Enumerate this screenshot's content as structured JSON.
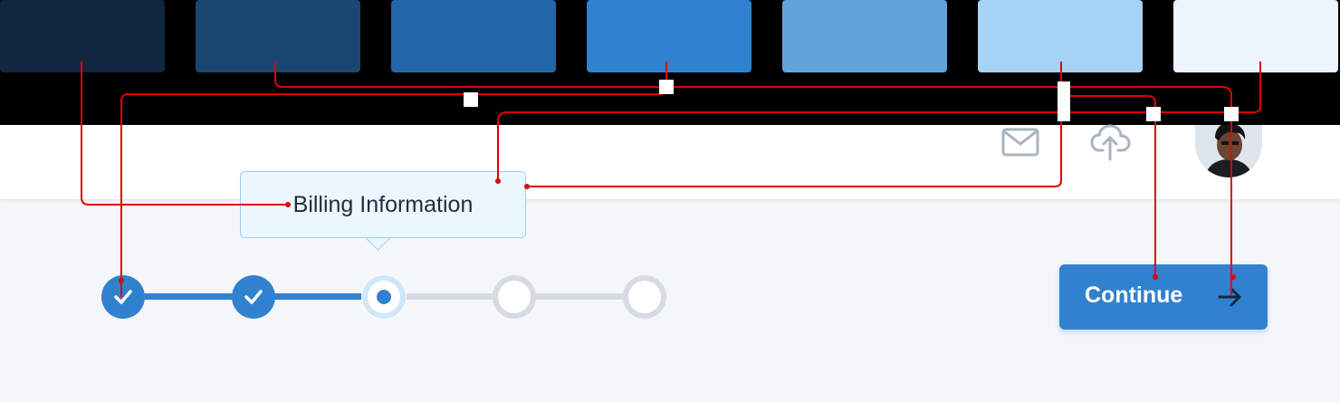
{
  "palette": [
    {
      "name": "blue-900",
      "hex": "#12263f"
    },
    {
      "name": "blue-800",
      "hex": "#1a4672"
    },
    {
      "name": "blue-700",
      "hex": "#2366a6"
    },
    {
      "name": "blue-600",
      "hex": "#3182ce"
    },
    {
      "name": "blue-400",
      "hex": "#63a3db"
    },
    {
      "name": "blue-200",
      "hex": "#a5d3f6"
    },
    {
      "name": "blue-50",
      "hex": "#ecf5fe"
    }
  ],
  "header": {
    "icons": [
      "mail-icon",
      "cloud-upload-icon"
    ],
    "avatar": "user-avatar"
  },
  "tooltip": {
    "text": "Billing Information"
  },
  "stepper": {
    "steps": [
      {
        "state": "complete"
      },
      {
        "state": "complete"
      },
      {
        "state": "current"
      },
      {
        "state": "upcoming"
      },
      {
        "state": "upcoming"
      }
    ]
  },
  "continue_button": {
    "label": "Continue",
    "icon": "arrow-right-icon"
  },
  "colors": {
    "annotation": "#e00000",
    "step_complete": "#3182ce",
    "step_upcoming": "#d6dbe1",
    "page_bg": "#f4f6fa",
    "header_bg": "#ffffff"
  }
}
